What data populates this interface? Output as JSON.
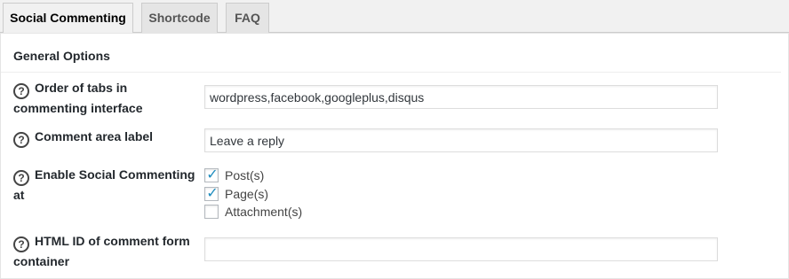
{
  "tabs": [
    {
      "label": "Social Commenting",
      "active": true
    },
    {
      "label": "Shortcode",
      "active": false
    },
    {
      "label": "FAQ",
      "active": false
    }
  ],
  "section": {
    "title": "General Options"
  },
  "help_icon": {
    "glyph": "?",
    "icon": "question-circle-icon"
  },
  "fields": {
    "order_tabs": {
      "label_line1": "Order of tabs in",
      "label_line2": "commenting interface",
      "value": "wordpress,facebook,googleplus,disqus"
    },
    "area_label": {
      "label": "Comment area label",
      "value": "Leave a reply"
    },
    "enable_at": {
      "label_line1": "Enable Social Commenting",
      "label_line2": "at",
      "options": [
        {
          "label": "Post(s)",
          "checked": true
        },
        {
          "label": "Page(s)",
          "checked": true
        },
        {
          "label": "Attachment(s)",
          "checked": false
        }
      ]
    },
    "form_container_id": {
      "label_line1": "HTML ID of comment form",
      "label_line2": "container",
      "value": ""
    }
  },
  "colors": {
    "accent": "#1e8cbe",
    "panel_bg": "#ffffff",
    "page_bg": "#f1f1f1"
  }
}
